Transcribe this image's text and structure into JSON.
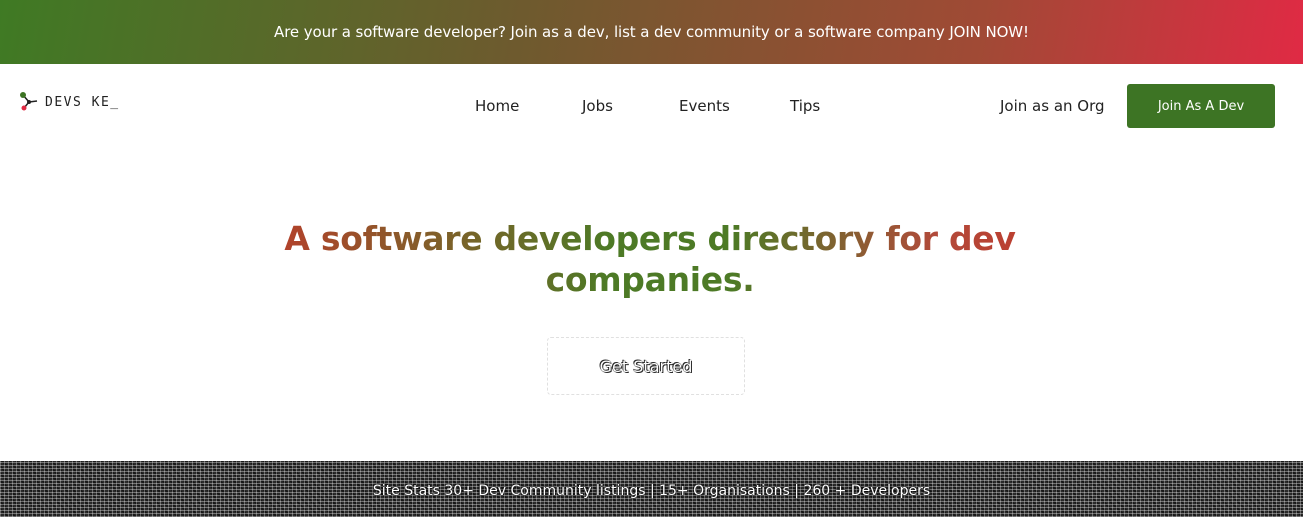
{
  "announcement": {
    "text": "Are your a software developer? Join as a dev, list a dev community or a software company JOIN NOW!"
  },
  "brand": {
    "logo_text": "DEVS KE_",
    "logo_icon": "network-nodes-icon"
  },
  "nav": {
    "items": [
      {
        "label": "Home"
      },
      {
        "label": "Jobs"
      },
      {
        "label": "Events"
      },
      {
        "label": "Tips"
      }
    ],
    "join_org_label": "Join as an Org",
    "join_dev_label": "Join As A Dev"
  },
  "hero": {
    "title_line1": "A software developers directory for dev",
    "title_line2": "companies.",
    "cta_label": "Get Started"
  },
  "stats": {
    "text": "Site Stats 30+ Dev Community listings | 15+ Organisations | 260 + Developers"
  },
  "colors": {
    "accent_green": "#3d7424",
    "accent_red": "#e02a44"
  }
}
